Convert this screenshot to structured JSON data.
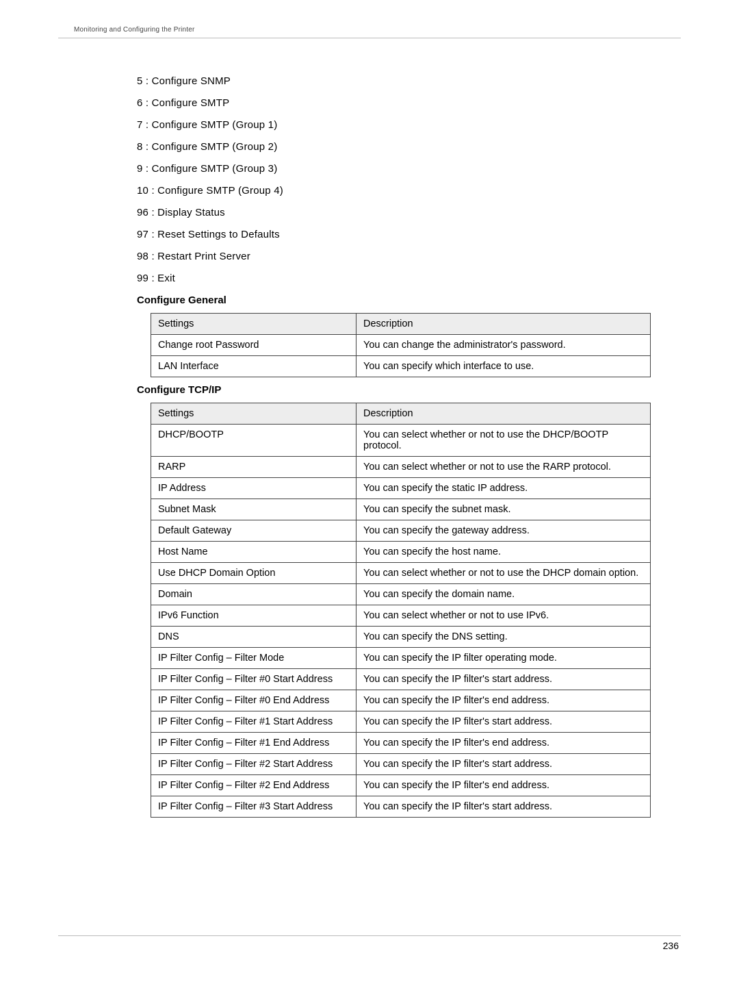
{
  "breadcrumb": "Monitoring and Configuring the Printer",
  "menu_items": [
    "5 : Configure SNMP",
    "6 : Configure SMTP",
    "7 : Configure SMTP (Group 1)",
    "8 : Configure SMTP (Group 2)",
    "9 : Configure SMTP (Group 3)",
    "10 : Configure SMTP (Group 4)",
    "96 : Display Status",
    "97 : Reset Settings to Defaults",
    "98 : Restart Print Server",
    "99 : Exit"
  ],
  "sections": {
    "general": {
      "title": "Configure General",
      "headers": {
        "c1": "Settings",
        "c2": "Description"
      },
      "rows": [
        {
          "s": "Change root Password",
          "d": "You can change the administrator's password."
        },
        {
          "s": "LAN Interface",
          "d": "You can specify which interface to use."
        }
      ]
    },
    "tcpip": {
      "title": "Configure TCP/IP",
      "headers": {
        "c1": "Settings",
        "c2": "Description"
      },
      "rows": [
        {
          "s": "DHCP/BOOTP",
          "d": "You can select whether or not to use the DHCP/BOOTP protocol."
        },
        {
          "s": "RARP",
          "d": "You can select whether or not to use the RARP protocol."
        },
        {
          "s": "IP Address",
          "d": "You can specify the static IP address."
        },
        {
          "s": "Subnet Mask",
          "d": "You can specify the subnet mask."
        },
        {
          "s": "Default Gateway",
          "d": "You can specify the gateway address."
        },
        {
          "s": "Host Name",
          "d": "You can specify the host name."
        },
        {
          "s": "Use DHCP Domain Option",
          "d": "You can select whether or not to use the DHCP domain option."
        },
        {
          "s": "Domain",
          "d": "You can specify the domain name."
        },
        {
          "s": "IPv6 Function",
          "d": "You can select whether or not to use IPv6."
        },
        {
          "s": "DNS",
          "d": "You can specify the DNS setting."
        },
        {
          "s": "IP Filter Config – Filter Mode",
          "d": "You can specify the IP filter operating mode."
        },
        {
          "s": "IP Filter Config – Filter #0 Start Address",
          "d": "You can specify the IP filter's start address."
        },
        {
          "s": "IP Filter Config – Filter #0 End Address",
          "d": "You can specify the IP filter's end address."
        },
        {
          "s": "IP Filter Config – Filter #1 Start Address",
          "d": "You can specify the IP filter's start address."
        },
        {
          "s": "IP Filter Config – Filter #1 End Address",
          "d": "You can specify the IP filter's end address."
        },
        {
          "s": "IP Filter Config – Filter #2 Start Address",
          "d": "You can specify the IP filter's start address."
        },
        {
          "s": "IP Filter Config – Filter #2 End Address",
          "d": "You can specify the IP filter's end address."
        },
        {
          "s": "IP Filter Config – Filter #3 Start Address",
          "d": "You can specify the IP filter's start address."
        }
      ]
    }
  },
  "page_number": "236"
}
